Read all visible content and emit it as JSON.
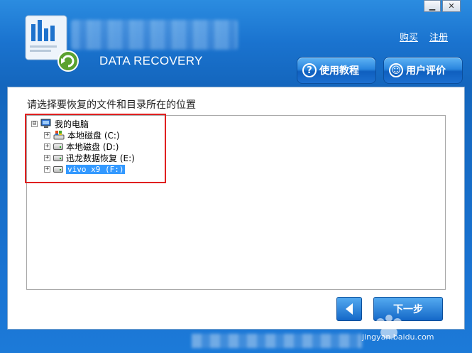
{
  "window": {
    "minimize_label": "▁",
    "close_label": "✕"
  },
  "header": {
    "product_name": "DATA RECOVERY",
    "links": {
      "buy": "购买",
      "register": "注册"
    },
    "buttons": {
      "tutorial": "使用教程",
      "review": "用户评价"
    }
  },
  "main": {
    "prompt": "请选择要恢复的文件和目录所在的位置",
    "tree": {
      "root": {
        "expander": "⊟",
        "label": "我的电脑"
      },
      "items": [
        {
          "expander": "+",
          "label": "本地磁盘 (C:)"
        },
        {
          "expander": "+",
          "label": "本地磁盘 (D:)"
        },
        {
          "expander": "+",
          "label": "迅龙数据恢复 (E:)"
        },
        {
          "expander": "+",
          "label": "vivo x9 (F:)",
          "selected": true
        }
      ]
    }
  },
  "footer": {
    "next_label": "下一步",
    "watermark": "jingyan.baidu.com"
  },
  "colors": {
    "accent": "#1a73cf",
    "highlight": "#e02020",
    "selection": "#3399ff"
  }
}
